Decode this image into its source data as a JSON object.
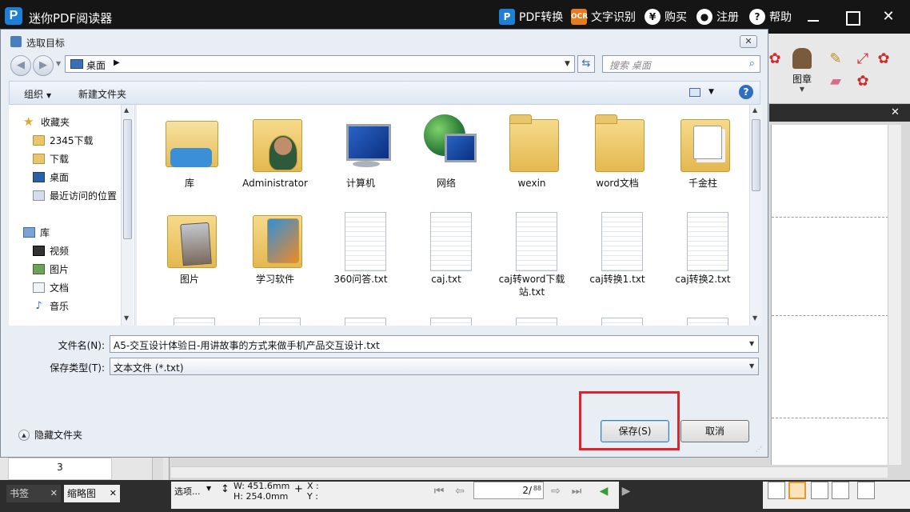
{
  "app": {
    "title": "迷你PDF阅读器",
    "logo_letter": "P",
    "menu": [
      {
        "label": "PDF转换",
        "icon": "pdf-convert-icon"
      },
      {
        "label": "文字识别",
        "icon": "ocr-icon"
      },
      {
        "label": "购买",
        "icon": "yen-icon"
      },
      {
        "label": "注册",
        "icon": "user-icon"
      },
      {
        "label": "帮助",
        "icon": "help-icon"
      }
    ]
  },
  "toolbar": {
    "stamp_label": "图章"
  },
  "dialog": {
    "title": "选取目标",
    "address_location": "桌面",
    "search_placeholder": "搜索 桌面",
    "organize_label": "组织",
    "new_folder_label": "新建文件夹",
    "nav": {
      "favorites_head": "收藏夹",
      "favorites": [
        "2345下载",
        "下载",
        "桌面",
        "最近访问的位置"
      ],
      "libraries_head": "库",
      "libraries": [
        "视频",
        "图片",
        "文档",
        "音乐"
      ]
    },
    "files": [
      {
        "name": "库",
        "kind": "library"
      },
      {
        "name": "Administrator",
        "kind": "user-folder"
      },
      {
        "name": "计算机",
        "kind": "computer"
      },
      {
        "name": "网络",
        "kind": "network"
      },
      {
        "name": "wexin",
        "kind": "folder"
      },
      {
        "name": "word文档",
        "kind": "folder"
      },
      {
        "name": "千金柱",
        "kind": "doc-folder"
      },
      {
        "name": "图片",
        "kind": "picture-folder"
      },
      {
        "name": "学习软件",
        "kind": "pdf-folder"
      },
      {
        "name": "360问答.txt",
        "kind": "txt"
      },
      {
        "name": "caj.txt",
        "kind": "txt"
      },
      {
        "name": "caj转word下载站.txt",
        "kind": "txt"
      },
      {
        "name": "caj转换1.txt",
        "kind": "txt"
      },
      {
        "name": "caj转换2.txt",
        "kind": "txt"
      }
    ],
    "filename_label": "文件名(N):",
    "filename_value": "A5-交互设计体验日-用讲故事的方式来做手机产品交互设计.txt",
    "filetype_label": "保存类型(T):",
    "filetype_value": "文本文件 (*.txt)",
    "hide_folders_label": "隐藏文件夹",
    "save_label": "保存(S)",
    "cancel_label": "取消"
  },
  "sidebar": {
    "thumbnail_page": "3"
  },
  "statusbar": {
    "bookmarks_tab": "书签",
    "thumbnails_tab": "缩略图",
    "select_label": "选项...",
    "width_text": "W: 451.6mm",
    "height_text": "H: 254.0mm",
    "x_text": "X :",
    "y_text": "Y :",
    "current_page": "2",
    "total_pages": "88"
  },
  "colors": {
    "titlebar": "#151515",
    "highlight_box": "#e3232a",
    "dialog_bg": "#e9eef5"
  }
}
